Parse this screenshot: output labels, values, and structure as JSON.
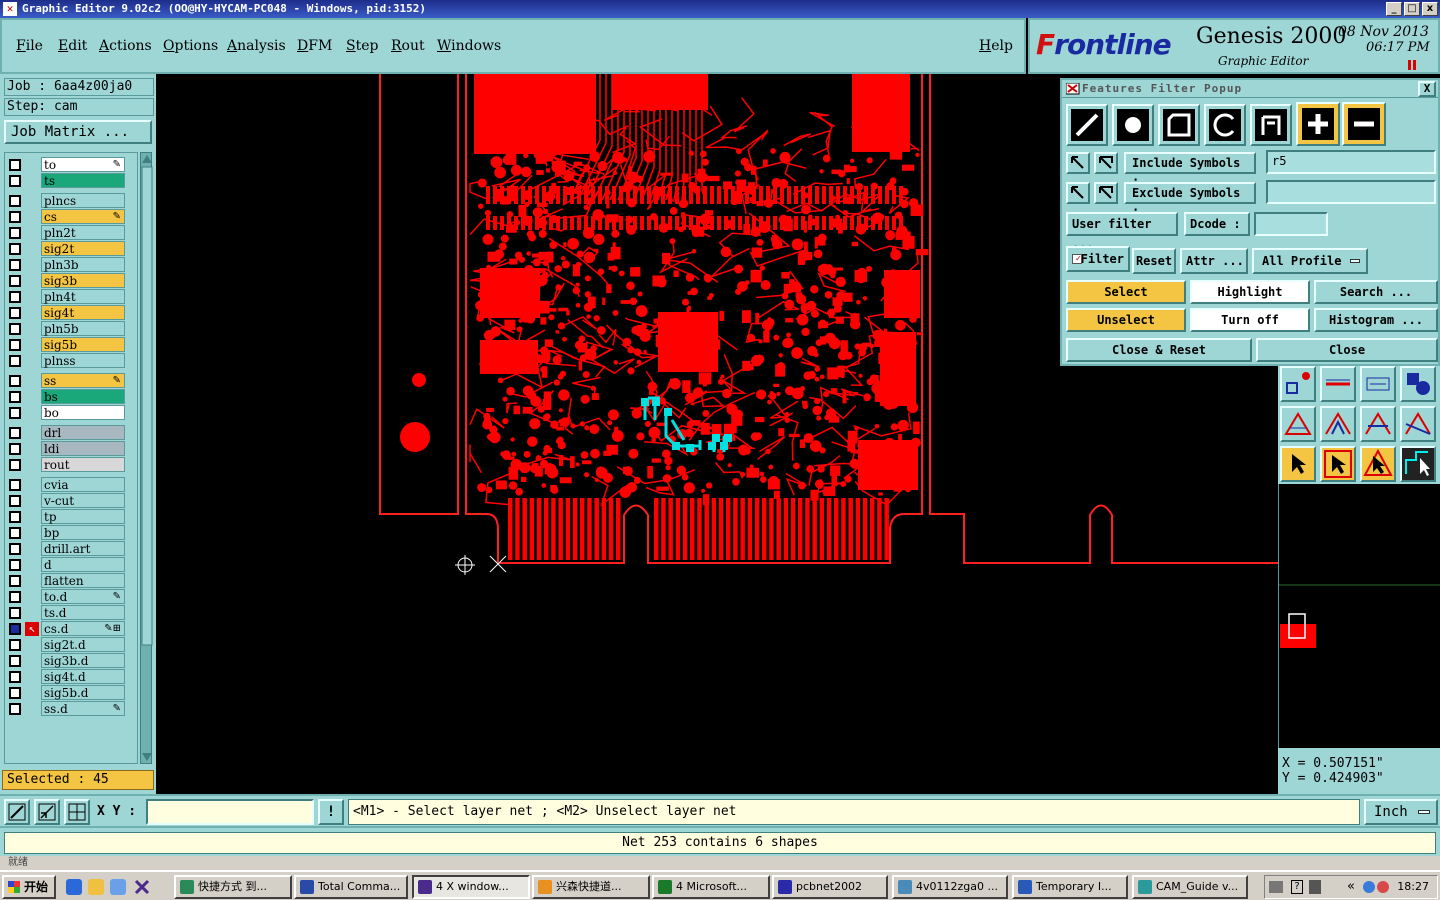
{
  "window": {
    "title": "Graphic Editor 9.02c2  (OO@HY-HYCAM-PC048 - Windows, pid:3152)",
    "min_label": "_",
    "max_label": "□",
    "close_label": "x"
  },
  "menu": {
    "items": [
      "File",
      "Edit",
      "Actions",
      "Options",
      "Analysis",
      "DFM",
      "Step",
      "Rout",
      "Windows"
    ],
    "help": "Help"
  },
  "brand": {
    "logo_prefix": "F",
    "logo_rest": "rontline",
    "product": "Genesis 2000",
    "subtitle": "Graphic Editor",
    "date": "08 Nov 2013",
    "time": "06:17 PM"
  },
  "job": {
    "job_line": "Job : 6aa4z00ja0",
    "step_line": "Step: cam",
    "matrix_button": "Job Matrix ..."
  },
  "layers": [
    {
      "name": "to",
      "color": "#ffffff",
      "flag": "✎"
    },
    {
      "name": "ts",
      "color": "#1aa87a",
      "flag": ""
    },
    {
      "name": "plncs",
      "color": "#9ed6d6",
      "flag": ""
    },
    {
      "name": "cs",
      "color": "#f4c542",
      "flag": "✎"
    },
    {
      "name": "pln2t",
      "color": "#9ed6d6",
      "flag": ""
    },
    {
      "name": "sig2t",
      "color": "#f4c542",
      "flag": ""
    },
    {
      "name": "pln3b",
      "color": "#9ed6d6",
      "flag": ""
    },
    {
      "name": "sig3b",
      "color": "#f4c542",
      "flag": ""
    },
    {
      "name": "pln4t",
      "color": "#9ed6d6",
      "flag": ""
    },
    {
      "name": "sig4t",
      "color": "#f4c542",
      "flag": ""
    },
    {
      "name": "pln5b",
      "color": "#9ed6d6",
      "flag": ""
    },
    {
      "name": "sig5b",
      "color": "#f4c542",
      "flag": ""
    },
    {
      "name": "plnss",
      "color": "#9ed6d6",
      "flag": ""
    },
    {
      "name": "ss",
      "color": "#f4c542",
      "flag": "✎"
    },
    {
      "name": "bs",
      "color": "#1aa87a",
      "flag": ""
    },
    {
      "name": "bo",
      "color": "#ffffff",
      "flag": ""
    },
    {
      "name": "drl",
      "color": "#a8b8c0",
      "flag": ""
    },
    {
      "name": "ldi",
      "color": "#a8b8c0",
      "flag": ""
    },
    {
      "name": "rout",
      "color": "#d8d8d8",
      "flag": ""
    },
    {
      "name": "cvia",
      "color": "#9ed6d6",
      "flag": ""
    },
    {
      "name": "v-cut",
      "color": "#9ed6d6",
      "flag": ""
    },
    {
      "name": "tp",
      "color": "#9ed6d6",
      "flag": ""
    },
    {
      "name": "bp",
      "color": "#9ed6d6",
      "flag": ""
    },
    {
      "name": "drill.art",
      "color": "#9ed6d6",
      "flag": ""
    },
    {
      "name": "d",
      "color": "#9ed6d6",
      "flag": ""
    },
    {
      "name": "flatten",
      "color": "#9ed6d6",
      "flag": ""
    },
    {
      "name": "to.d",
      "color": "#9ed6d6",
      "flag": "✎"
    },
    {
      "name": "ts.d",
      "color": "#9ed6d6",
      "flag": ""
    },
    {
      "name": "cs.d",
      "color": "#9ed6d6",
      "flag": "✎⊞"
    },
    {
      "name": "sig2t.d",
      "color": "#9ed6d6",
      "flag": ""
    },
    {
      "name": "sig3b.d",
      "color": "#9ed6d6",
      "flag": ""
    },
    {
      "name": "sig4t.d",
      "color": "#9ed6d6",
      "flag": ""
    },
    {
      "name": "sig5b.d",
      "color": "#9ed6d6",
      "flag": ""
    },
    {
      "name": "ss.d",
      "color": "#9ed6d6",
      "flag": "✎"
    }
  ],
  "selected_text": "Selected : 45",
  "filter_popup": {
    "title": "Features Filter Popup",
    "close_label": "X",
    "include_label": "Include Symbols :",
    "include_value": "r5",
    "exclude_label": "Exclude Symbols :",
    "exclude_value": "",
    "user_filter": "User filter ...",
    "dcode_label": "Dcode :",
    "dcode_value": "",
    "filter_toggle": "Filter",
    "reset": "Reset",
    "attr": "Attr ...",
    "profile": "All Profile",
    "select": "Select",
    "highlight": "Highlight",
    "search": "Search ...",
    "unselect": "Unselect",
    "turn_off": "Turn off",
    "histogram": "Histogram ...",
    "close_reset": "Close & Reset",
    "close": "Close"
  },
  "coords": {
    "x": "X = 0.507151\"",
    "y": "Y = 0.424903\""
  },
  "command": {
    "xy_label": "X Y :",
    "xy_value": "",
    "alert_label": "!",
    "hint": "<M1> - Select layer net ; <M2> Unselect layer net",
    "units": "Inch"
  },
  "status_message": "Net 253 contains 6 shapes",
  "ghost_text": "就绪",
  "taskbar": {
    "start": "开始",
    "tasks": [
      "快捷方式 到...",
      "Total Comma...",
      "4 X window...",
      "兴森快捷道...",
      "4 Microsoft...",
      "pcbnet2002",
      "4v0112zga0 ...",
      "Temporary I...",
      "CAM_Guide v..."
    ],
    "clock": "18:27",
    "tray_chevron": "«"
  },
  "colors": {
    "panel": "#9ed6d6",
    "copper": "#ff0000",
    "highlight_net": "#00e0e0",
    "profile_line": "#ff2020"
  }
}
